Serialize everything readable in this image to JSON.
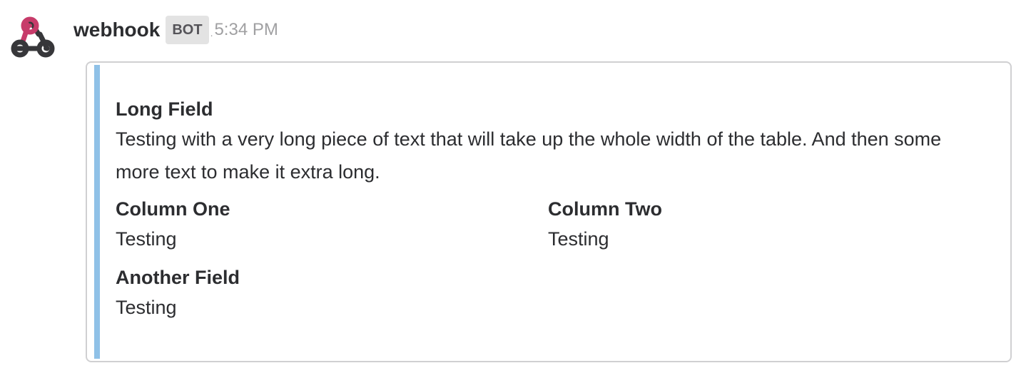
{
  "message": {
    "sender": "webhook",
    "badge": "BOT",
    "separator": ".",
    "timestamp": "5:34 PM"
  },
  "attachment": {
    "bar_color": "#8fc1e7",
    "long_field": {
      "title": "Long Field",
      "value": "Testing with a very long piece of text that will take up the whole width of the table. And then some more text to make it extra long."
    },
    "fields": [
      {
        "title": "Column One",
        "value": "Testing"
      },
      {
        "title": "Column Two",
        "value": "Testing"
      },
      {
        "title": "Another Field",
        "value": "Testing"
      }
    ]
  },
  "icons": {
    "avatar": "webhook-icon",
    "avatar_colors": {
      "dark": "#37373a",
      "accent": "#c73b6a"
    }
  }
}
